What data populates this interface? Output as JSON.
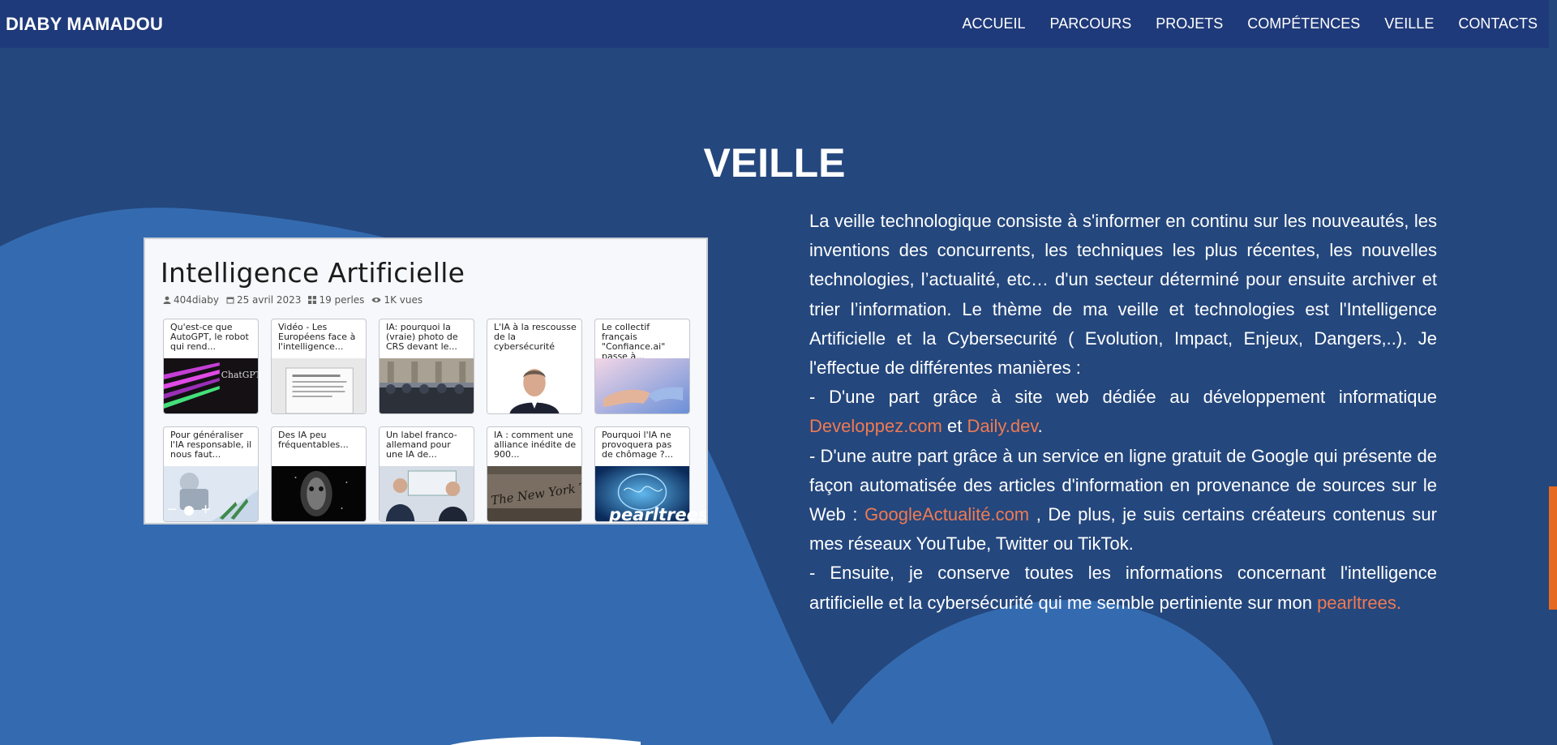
{
  "navbar": {
    "brand": "DIABY MAMADOU",
    "links": [
      "ACCUEIL",
      "PARCOURS",
      "PROJETS",
      "COMPÉTENCES",
      "VEILLE",
      "CONTACTS"
    ]
  },
  "section": {
    "title": "VEILLE"
  },
  "embed": {
    "title": "Intelligence Artificielle",
    "meta": {
      "author": "404diaby",
      "date": "25 avril 2023",
      "pearls": "19 perles",
      "views": "1K vues"
    },
    "tiles": [
      {
        "caption": "Qu'est-ce que AutoGPT, le robot qui rend...",
        "thumb": "chatgpt-screen"
      },
      {
        "caption": "Vidéo - Les Européens face à l'intelligence...",
        "thumb": "document-page"
      },
      {
        "caption": "IA: pourquoi la (vraie) photo de CRS devant le...",
        "thumb": "riot-police-photo"
      },
      {
        "caption": "L'IA à la rescousse de la cybersécurité",
        "thumb": "man-portrait"
      },
      {
        "caption": "Le collectif français \"Confiance.ai\" passe à...",
        "thumb": "handshake"
      },
      {
        "caption": "Pour généraliser l'IA responsable, il nous faut...",
        "thumb": "robot-hand"
      },
      {
        "caption": "Des IA peu fréquentables...",
        "thumb": "dark-face"
      },
      {
        "caption": "Un label franco-allemand pour une IA de...",
        "thumb": "two-men-photo"
      },
      {
        "caption": "IA : comment une alliance inédite de 900...",
        "thumb": "new-york-times"
      },
      {
        "caption": "Pourquoi l'IA ne provoquera pas de chômage ?...",
        "thumb": "blue-brain"
      }
    ],
    "zoom": {
      "minus": "−",
      "plus": "+"
    },
    "logo": "pearltrees"
  },
  "intro": {
    "p1": "La veille technologique consiste à s'informer en continu sur les nouveautés, les inventions des concurrents, les techniques les plus récentes, les nouvelles technologies, l’actualité, etc… d'un secteur déterminé pour ensuite archiver et trier l’information. Le thème de ma veille et technologies est l'Intelligence Artificielle et la Cybersecurité ( Evolution, Impact, Enjeux, Dangers,..). Je l'effectue de différentes manières :",
    "p2_start": "- D'une part grâce à site web dédiée au développement informatique",
    "link_developpez": "Developpez.com",
    "p2_and": " et ",
    "link_dailydev": "Daily.dev",
    "p2_end": ".",
    "p3_start": "- D'une autre part grâce à un service en ligne gratuit de Google qui présente de façon automatisée des articles d'information en provenance de sources sur le Web : ",
    "link_google": "GoogleActualité.com",
    "p3_end": " , De plus, je suis certains créateurs contenus sur mes réseaux YouTube, Twitter ou TikTok.",
    "p4_start": "- Ensuite, je conserve toutes les informations concernant l'intelligence artificielle et la cybersécurité qui me semble pertiniente sur mon ",
    "link_pearltrees": "pearltrees."
  },
  "colors": {
    "background": "#24477d",
    "navbar": "#1f3a7a",
    "wave": "#346bb0",
    "link": "#f07a52",
    "scrollbar_thumb": "#e66a1f"
  }
}
